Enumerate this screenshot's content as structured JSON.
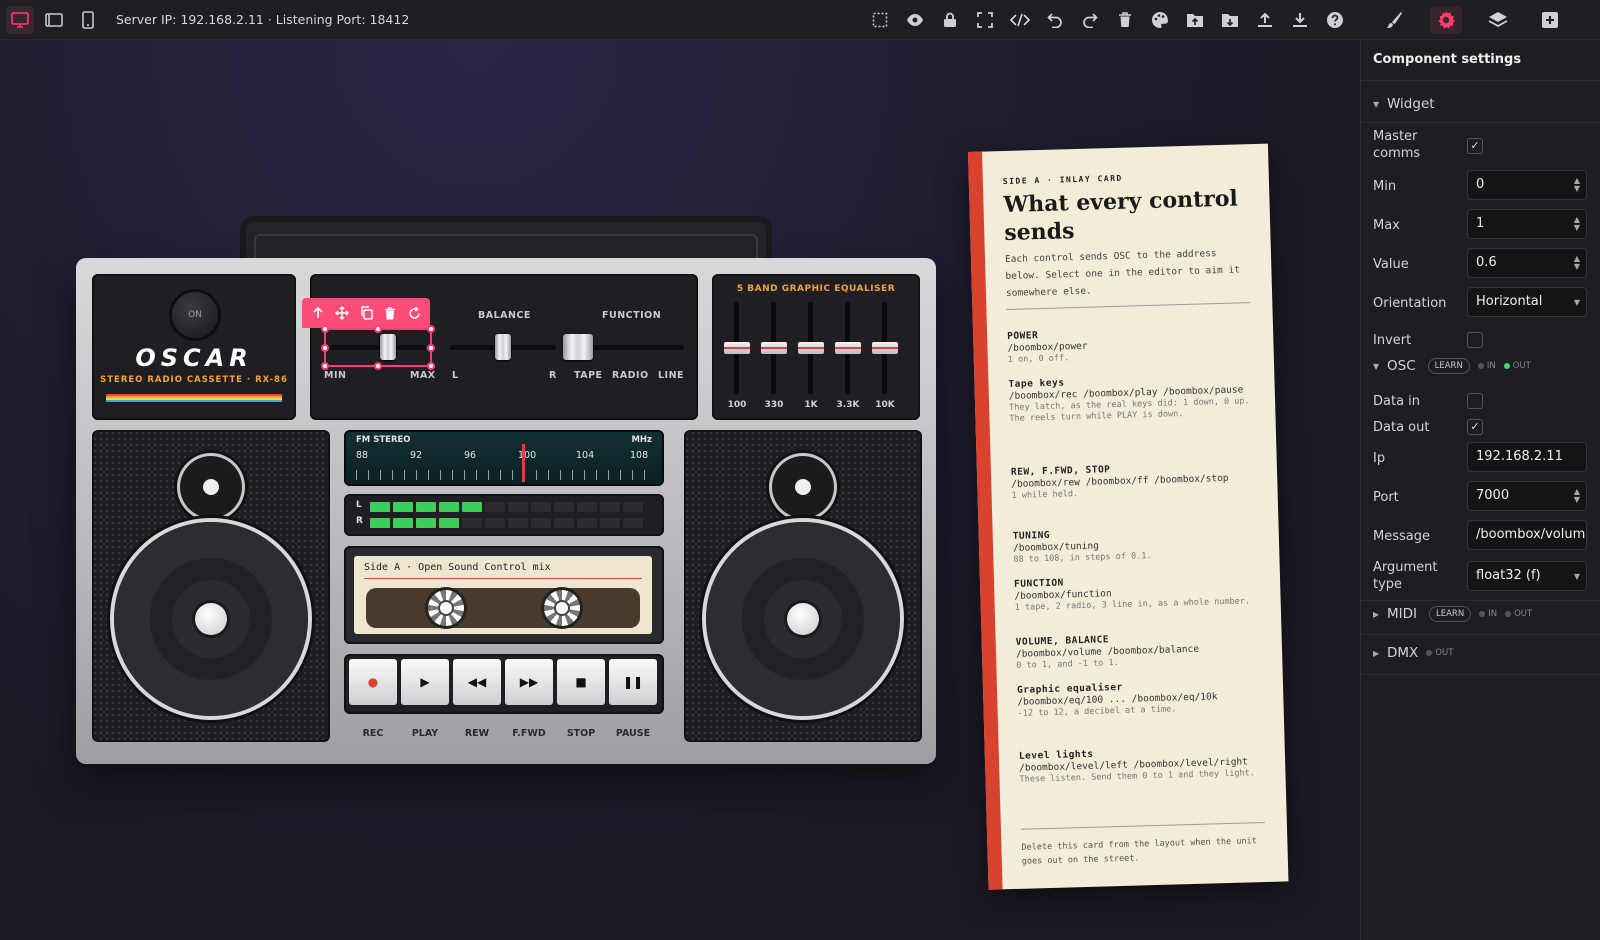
{
  "topbar": {
    "server_info": "Server IP: 192.168.2.11 · Listening Port: 18412",
    "tools": [
      "select-area",
      "preview",
      "lock",
      "fullscreen",
      "code",
      "undo",
      "redo",
      "delete",
      "theme",
      "open-folder",
      "import",
      "upload",
      "download",
      "help"
    ],
    "right_tools": [
      "brush",
      "settings",
      "layers",
      "add"
    ]
  },
  "boombox": {
    "power_label": "ON",
    "brand": "OSCAR",
    "model": "STEREO RADIO CASSETTE · RX-86",
    "volume": {
      "min_label": "MIN",
      "max_label": "MAX",
      "value": 0.6
    },
    "balance": {
      "title": "BALANCE",
      "left_label": "L",
      "right_label": "R",
      "value": 0
    },
    "function": {
      "title": "FUNCTION",
      "options": [
        "TAPE",
        "RADIO",
        "LINE"
      ],
      "value": 1
    },
    "eq": {
      "title": "5 BAND GRAPHIC EQUALISER",
      "bands": [
        "100",
        "330",
        "1K",
        "3.3K",
        "10K"
      ],
      "values": [
        0,
        0,
        0,
        0,
        0
      ]
    },
    "tuner": {
      "band_label": "FM STEREO",
      "unit": "MHz",
      "scale": [
        "88",
        "92",
        "96",
        "100",
        "104",
        "108"
      ],
      "value": 99.2
    },
    "levels": {
      "left_label": "L",
      "right_label": "R",
      "left": 0.45,
      "right": 0.35
    },
    "cassette": {
      "title": "Side A · Open Sound Control mix"
    },
    "keys": [
      {
        "label": "REC",
        "glyph": "●",
        "color": "#d9422f"
      },
      {
        "label": "PLAY",
        "glyph": "▶",
        "color": "#111111"
      },
      {
        "label": "REW",
        "glyph": "◀◀",
        "color": "#111111"
      },
      {
        "label": "F.FWD",
        "glyph": "▶▶",
        "color": "#111111"
      },
      {
        "label": "STOP",
        "glyph": "■",
        "color": "#111111"
      },
      {
        "label": "PAUSE",
        "glyph": "❚❚",
        "color": "#111111"
      }
    ]
  },
  "card": {
    "kicker": "SIDE A · INLAY CARD",
    "title": "What every control sends",
    "intro": "Each control sends OSC to the address below. Select one in the editor to aim it somewhere else.",
    "sections": [
      {
        "h": "POWER",
        "a": "/boombox/power",
        "d": "1 on, 0 off."
      },
      {
        "h": "Tape keys",
        "a": "/boombox/rec /boombox/play /boombox/pause",
        "d": "They latch, as the real keys did: 1 down, 0 up. The reels turn while PLAY is down."
      },
      {
        "h": "REW, F.FWD, STOP",
        "a": "/boombox/rew /boombox/ff /boombox/stop",
        "d": "1 while held."
      },
      {
        "h": "TUNING",
        "a": "/boombox/tuning",
        "d": "88 to 108, in steps of 0.1."
      },
      {
        "h": "FUNCTION",
        "a": "/boombox/function",
        "d": "1 tape, 2 radio, 3 line in, as a whole number."
      },
      {
        "h": "VOLUME, BALANCE",
        "a": "/boombox/volume /boombox/balance",
        "d": "0 to 1, and -1 to 1."
      },
      {
        "h": "Graphic equaliser",
        "a": "/boombox/eq/100 ... /boombox/eq/10k",
        "d": "-12 to 12, a decibel at a time."
      },
      {
        "h": "Level lights",
        "a": "/boombox/level/left /boombox/level/right",
        "d": "These listen. Send them 0 to 1 and they light."
      }
    ],
    "footer": "Delete this card from the layout when the unit goes out on the street."
  },
  "panel": {
    "title": "Component settings",
    "widget_group": "Widget",
    "master_comms": {
      "label": "Master comms",
      "checked": true
    },
    "min": {
      "label": "Min",
      "value": "0"
    },
    "max": {
      "label": "Max",
      "value": "1"
    },
    "value": {
      "label": "Value",
      "value": "0.6"
    },
    "orientation": {
      "label": "Orientation",
      "value": "Horizontal"
    },
    "invert": {
      "label": "Invert",
      "checked": false
    },
    "osc_group": "OSC",
    "learn_label": "LEARN",
    "in_label": "IN",
    "out_label": "OUT",
    "data_in": {
      "label": "Data in",
      "checked": false
    },
    "data_out": {
      "label": "Data out",
      "checked": true
    },
    "ip": {
      "label": "Ip",
      "value": "192.168.2.11"
    },
    "port": {
      "label": "Port",
      "value": "7000"
    },
    "message": {
      "label": "Message",
      "value": "/boombox/volume"
    },
    "arg_type": {
      "label": "Argument type",
      "value": "float32 (f)"
    },
    "midi_group": "MIDI",
    "dmx_group": "DMX"
  },
  "colors": {
    "accent": "#ff3d6e",
    "led_on": "#3bcf5a",
    "led_off": "#2c2c30",
    "eq_label": "#f2a33a"
  }
}
